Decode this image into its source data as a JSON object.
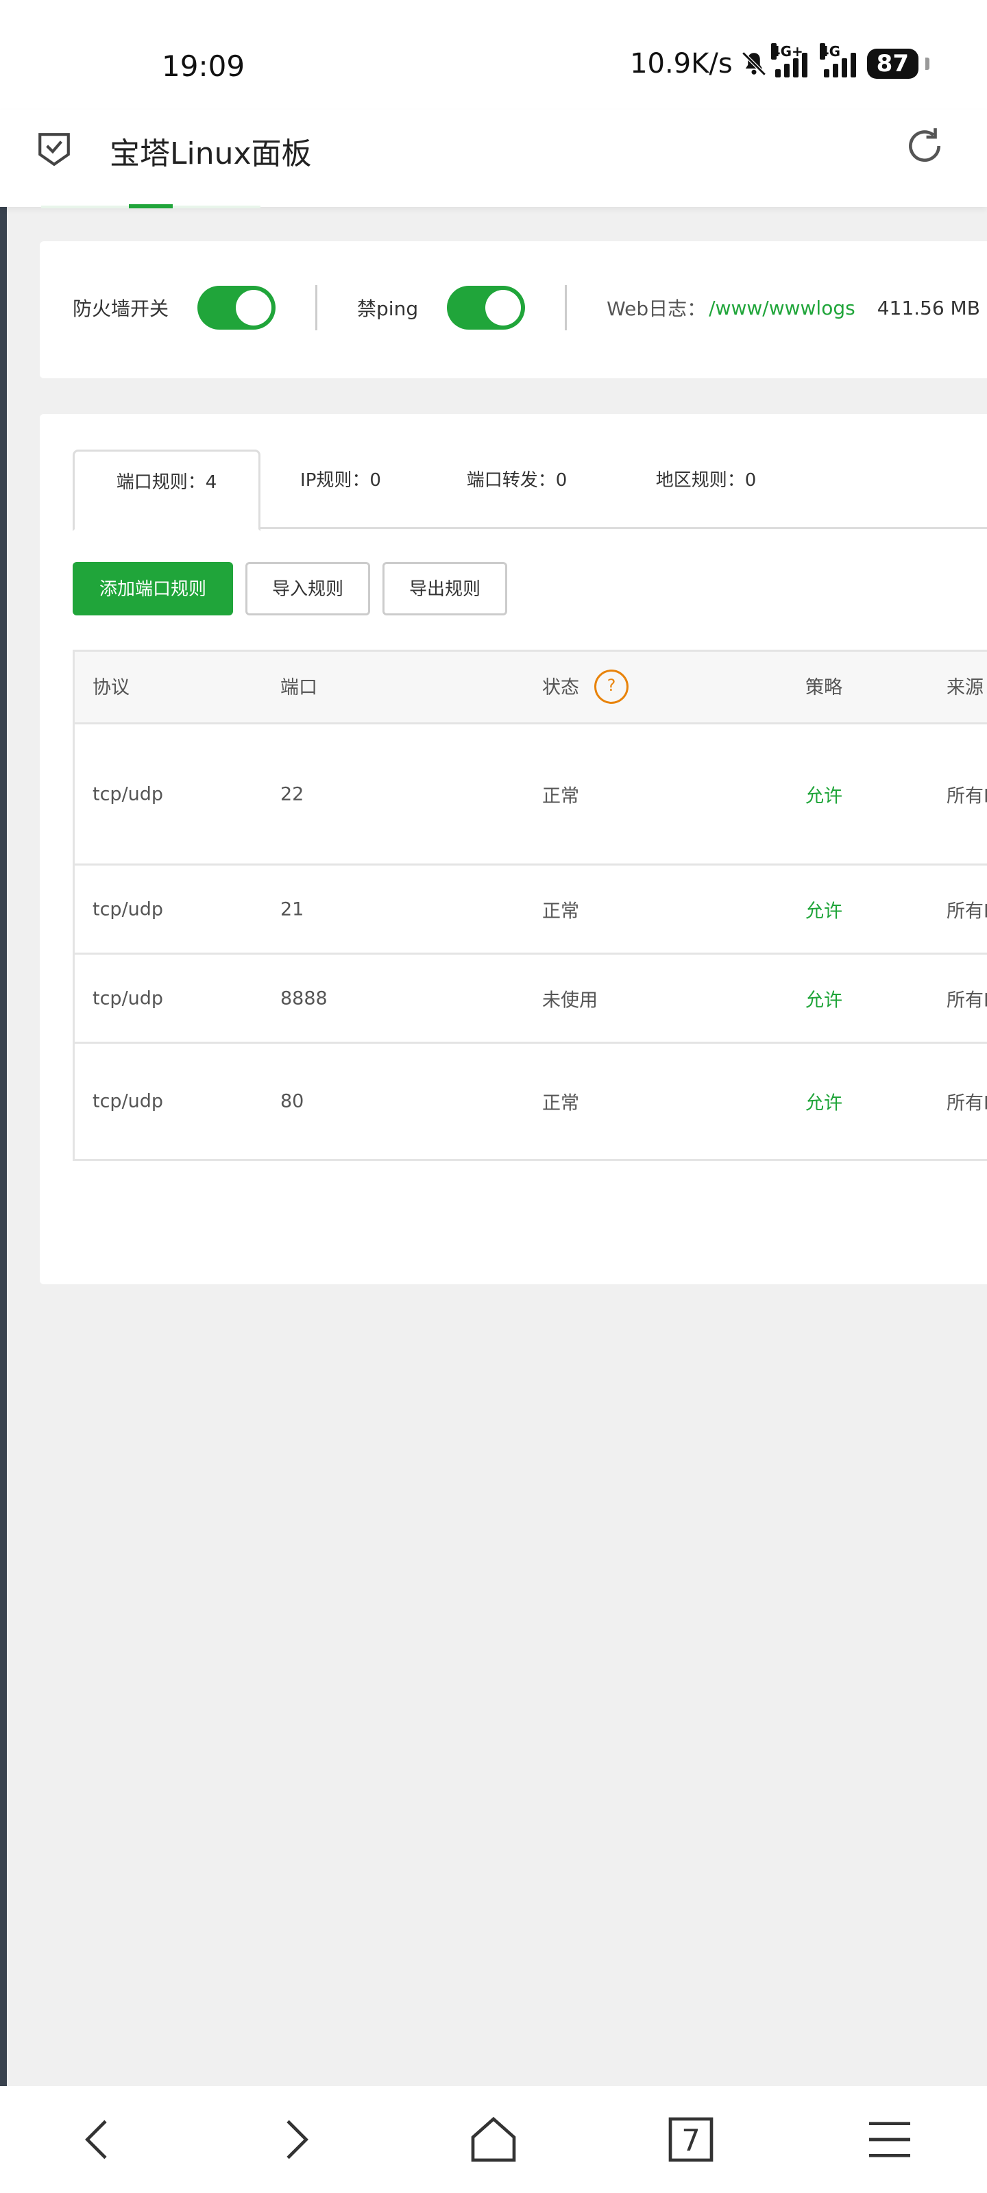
{
  "status": {
    "time": "19:09",
    "speed": "10.9K/s",
    "battery": "87",
    "net1": "4G+",
    "net2": "4G"
  },
  "header": {
    "title": "宝塔Linux面板"
  },
  "firewall": {
    "switch_label": "防火墙开关",
    "ping_label": "禁ping",
    "weblog_label": "Web日志：",
    "weblog_path": "/www/wwwlogs",
    "weblog_size": "411.56 MB"
  },
  "tabs": [
    {
      "label": "端口规则：4"
    },
    {
      "label": "IP规则：0"
    },
    {
      "label": "端口转发：0"
    },
    {
      "label": "地区规则：0"
    }
  ],
  "buttons": {
    "add": "添加端口规则",
    "import": "导入规则",
    "export": "导出规则"
  },
  "table": {
    "headers": [
      "协议",
      "端口",
      "状态",
      "策略",
      "来源"
    ],
    "help_glyph": "?",
    "rows": [
      {
        "protocol": "tcp/udp",
        "port": "22",
        "status": "正常",
        "policy": "允许",
        "source": "所有I"
      },
      {
        "protocol": "tcp/udp",
        "port": "21",
        "status": "正常",
        "policy": "允许",
        "source": "所有I"
      },
      {
        "protocol": "tcp/udp",
        "port": "8888",
        "status": "未使用",
        "policy": "允许",
        "source": "所有I"
      },
      {
        "protocol": "tcp/udp",
        "port": "80",
        "status": "正常",
        "policy": "允许",
        "source": "所有I"
      }
    ]
  },
  "nav": {
    "tabs_count": "7"
  },
  "colors": {
    "accent": "#20a53a",
    "warning": "#e8830b"
  }
}
